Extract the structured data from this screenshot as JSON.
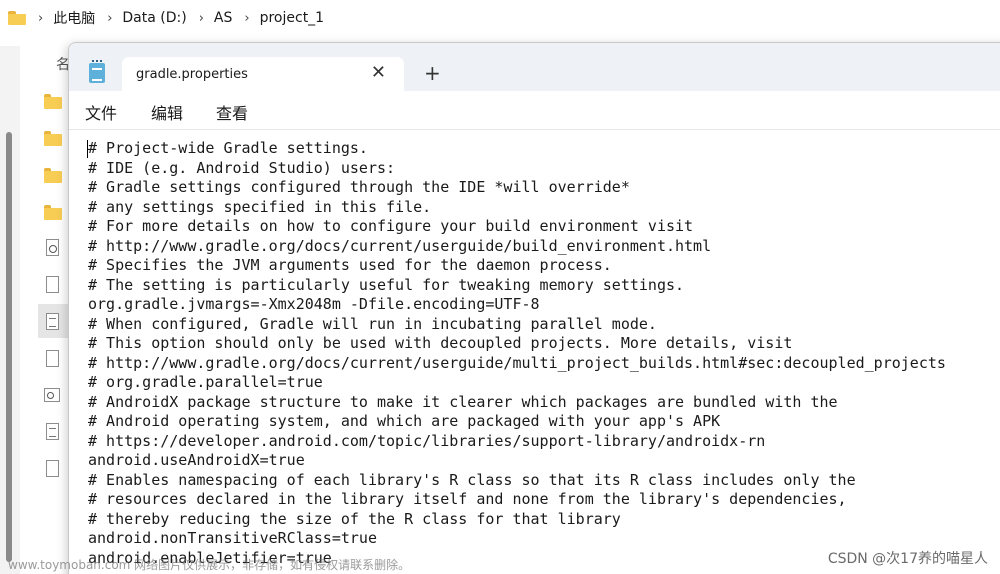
{
  "explorer": {
    "breadcrumb": [
      "此电脑",
      "Data (D:)",
      "AS",
      "project_1"
    ],
    "column_header": "名"
  },
  "notepad": {
    "tab_title": "gradle.properties",
    "close_glyph": "✕",
    "new_tab_glyph": "+",
    "menu": {
      "file": "文件",
      "edit": "编辑",
      "view": "查看"
    },
    "lines": [
      "# Project-wide Gradle settings.",
      "# IDE (e.g. Android Studio) users:",
      "# Gradle settings configured through the IDE *will override*",
      "# any settings specified in this file.",
      "# For more details on how to configure your build environment visit",
      "# http://www.gradle.org/docs/current/userguide/build_environment.html",
      "# Specifies the JVM arguments used for the daemon process.",
      "# The setting is particularly useful for tweaking memory settings.",
      "org.gradle.jvmargs=-Xmx2048m -Dfile.encoding=UTF-8",
      "# When configured, Gradle will run in incubating parallel mode.",
      "# This option should only be used with decoupled projects. More details, visit",
      "# http://www.gradle.org/docs/current/userguide/multi_project_builds.html#sec:decoupled_projects",
      "# org.gradle.parallel=true",
      "# AndroidX package structure to make it clearer which packages are bundled with the",
      "# Android operating system, and which are packaged with your app's APK",
      "# https://developer.android.com/topic/libraries/support-library/androidx-rn",
      "android.useAndroidX=true",
      "# Enables namespacing of each library's R class so that its R class includes only the",
      "# resources declared in the library itself and none from the library's dependencies,",
      "# thereby reducing the size of the R class for that library",
      "android.nonTransitiveRClass=true",
      "android.enableJetifier=true"
    ]
  },
  "watermarks": {
    "left": "www.toymoban.com 网络图片仅供展示，非存储，如有侵权请联系删除。",
    "right": "CSDN @次17养的喵星人"
  },
  "icons": {
    "folder": "folder-icon",
    "notepad": "notepad-app-icon",
    "close": "close-icon",
    "plus": "plus-icon"
  }
}
